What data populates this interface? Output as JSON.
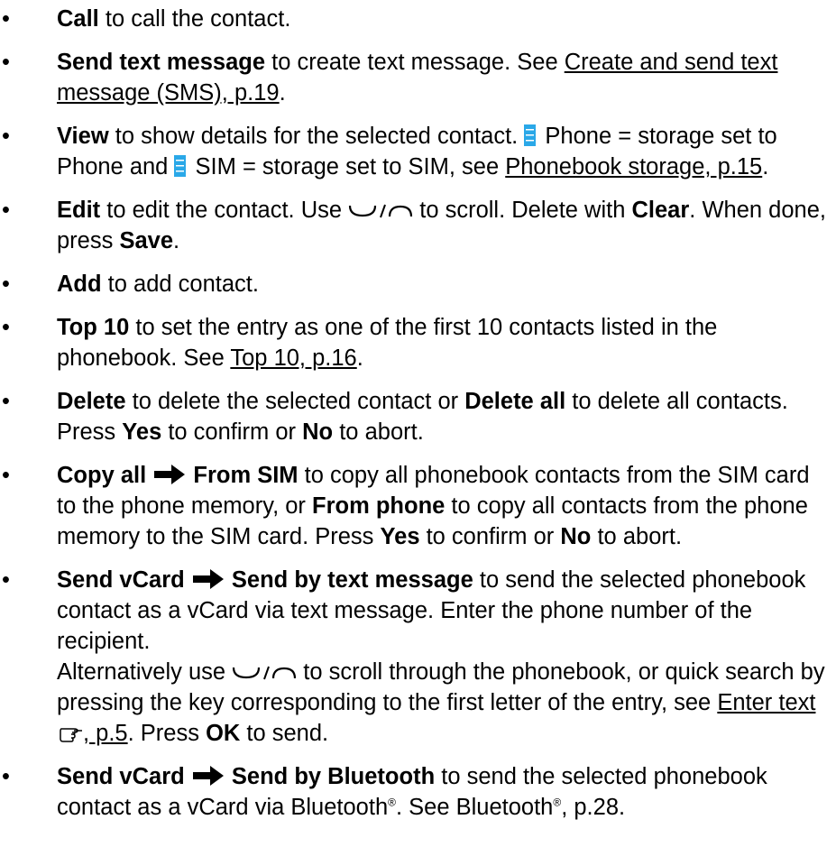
{
  "bullet": "•",
  "items": [
    {
      "t1": "Call",
      "x1": " to call the contact."
    },
    {
      "t1": "Send text message",
      "x1": " to create text message. See ",
      "r1": "Create and send text message (SMS), p.19",
      "x2": "."
    },
    {
      "t1": "View",
      "x1": " to show details for the selected contact. ",
      "x2": " Phone = storage set to Phone and ",
      "x3": " SIM = storage set to SIM, see ",
      "r1": "Phonebook storage, p.15",
      "x4": "."
    },
    {
      "t1": "Edit",
      "x1": " to edit the contact. Use ",
      "x2": " to scroll. Delete with ",
      "t2": "Clear",
      "x3": ". When done, press ",
      "t3": "Save",
      "x4": "."
    },
    {
      "t1": "Add",
      "x1": " to add contact."
    },
    {
      "t1": "Top 10",
      "x1": " to set the entry as one of the first 10 contacts listed in the phonebook. See ",
      "r1": "Top 10, p.16",
      "x2": "."
    },
    {
      "t1": "Delete",
      "x1": " to delete the selected contact or ",
      "t2": "Delete all",
      "x2": " to delete all contacts. Press ",
      "t3": "Yes",
      "x3": " to confirm or ",
      "t4": "No",
      "x4": " to abort."
    },
    {
      "t1": "Copy all",
      "t2": "From SIM",
      "x1": " to copy all phonebook contacts from the SIM card to the phone memory, or ",
      "t3": "From phone",
      "x2": " to copy all contacts from the phone memory to the SIM card. Press ",
      "t4": "Yes",
      "x3": " to confirm or ",
      "t5": "No",
      "x4": " to abort."
    },
    {
      "t1": "Send vCard",
      "t2": "Send by text message",
      "x1": " to send the selected phonebook contact as a vCard via text message. Enter the phone number of the recipient.",
      "x2": "Alternatively use ",
      "x3": " to scroll through the phonebook, or quick search by pressing the key corresponding to the first letter of the entry, see ",
      "r1": "Enter text",
      "r2": ", p.5",
      "x4": ". Press ",
      "t3": "OK",
      "x5": " to send."
    },
    {
      "t1": "Send vCard",
      "t2": "Send by Bluetooth",
      "x1": " to send the selected phonebook contact as a vCard via Bluetooth",
      "reg1": "®",
      "x2": ". See Bluetooth",
      "reg2": "®",
      "x3": ", p.28."
    }
  ],
  "colors": {
    "text": "#000000",
    "accent_icon": "#2aa8e8"
  },
  "icons": {
    "storage": "phone-storage-icon",
    "nav": "scroll-up-down-icon",
    "arrow": "right-arrow-icon",
    "hand": "pointing-hand-icon"
  }
}
